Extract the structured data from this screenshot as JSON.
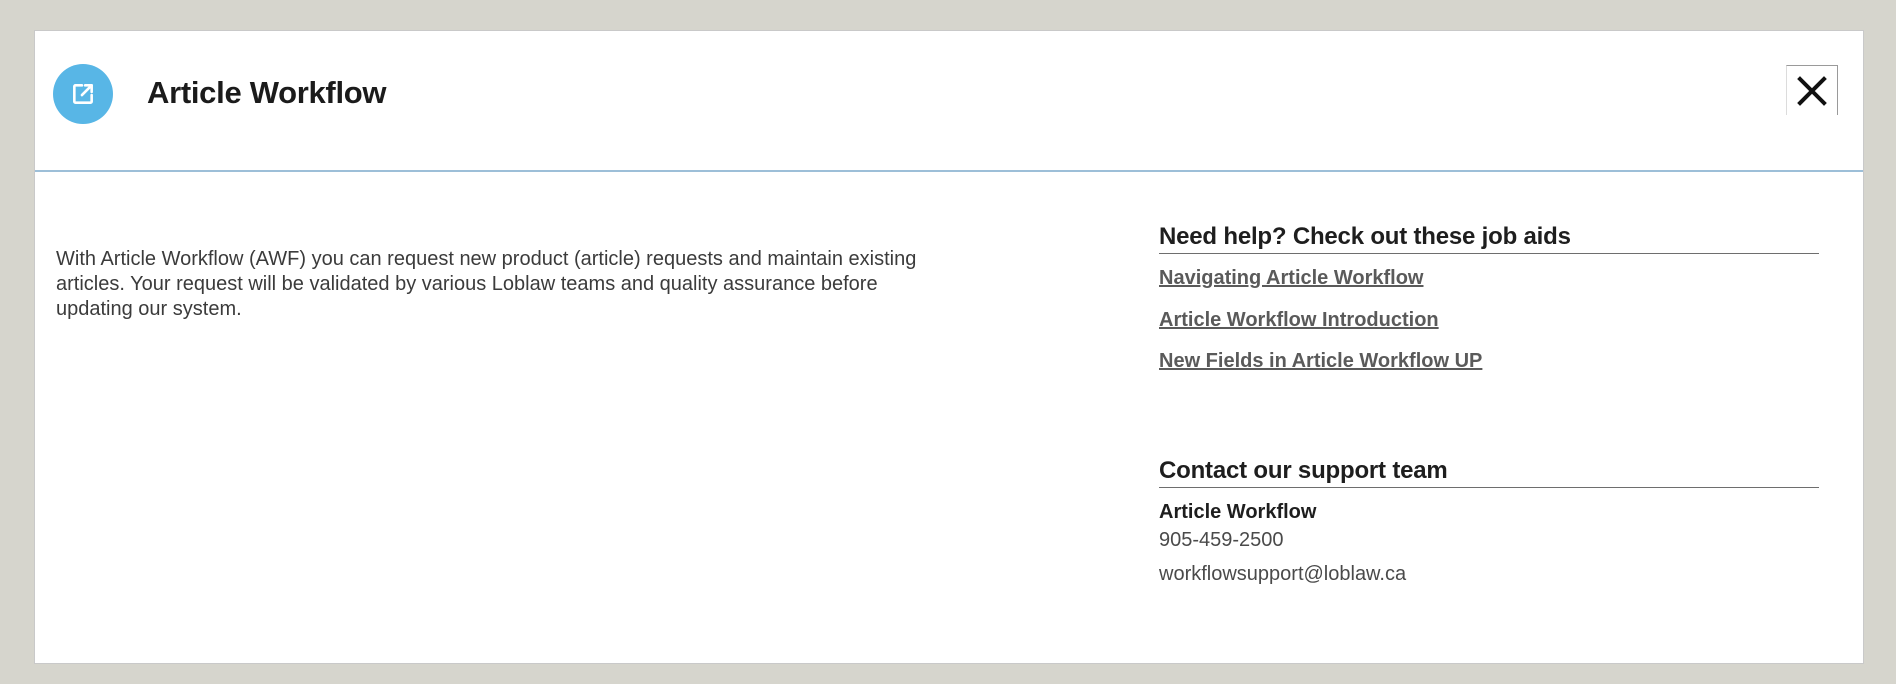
{
  "dialog": {
    "title": "Article Workflow",
    "header_icon": "external-edit-icon",
    "close_icon": "close-icon",
    "accent_color": "#58b6e6"
  },
  "main": {
    "description": "With Article Workflow (AWF) you can request new product (article) requests and maintain existing articles. Your request will be validated by various Loblaw teams and quality assurance before updating our system."
  },
  "help": {
    "heading": "Need help? Check out these job aids",
    "links": [
      "Navigating Article Workflow",
      "Article Workflow Introduction",
      "New Fields in Article Workflow UP"
    ]
  },
  "contact": {
    "heading": "Contact our support team",
    "name": "Article Workflow",
    "phone": "905-459-2500",
    "email": "workflowsupport@loblaw.ca"
  }
}
